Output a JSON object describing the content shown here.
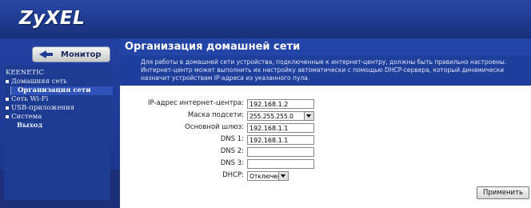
{
  "header": {
    "logo_text": "ZyXEL"
  },
  "sidebar": {
    "monitor_label": "Монитор",
    "group_label": "KEENETIC",
    "items": [
      {
        "label": "Домашняя сеть"
      },
      {
        "label": "Организация сети"
      },
      {
        "label": "Сеть Wi-Fi"
      },
      {
        "label": "USB-приложения"
      },
      {
        "label": "Система"
      },
      {
        "label": "Выход"
      }
    ]
  },
  "main": {
    "title": "Организация домашней сети",
    "description": "Для работы в домашней сети устройства, подключенные к интернет-центру, должны быть правильно настроены. Интернет-центр может выполнить их настройку автоматически с помощью DHCP-сервера, который динамически назначит устройствам IP-адреса из указанного пула.",
    "fields": {
      "ip_label": "IP-адрес интернет-центра:",
      "ip_value": "192.168.1.2",
      "mask_label": "Маска подсети:",
      "mask_value": "255.255.255.0",
      "gateway_label": "Основной шлюз:",
      "gateway_value": "192.168.1.1",
      "dns1_label": "DNS 1:",
      "dns1_value": "192.168.1.1",
      "dns2_label": "DNS 2:",
      "dns2_value": "",
      "dns3_label": "DNS 3:",
      "dns3_value": "",
      "dhcp_label": "DHCP:",
      "dhcp_value": "Отключен"
    },
    "apply_label": "Применить"
  },
  "colors": {
    "header_blue": "#1e3a8f",
    "sidebar_blue": "#1d3b91",
    "title_blue": "#2244a6"
  }
}
